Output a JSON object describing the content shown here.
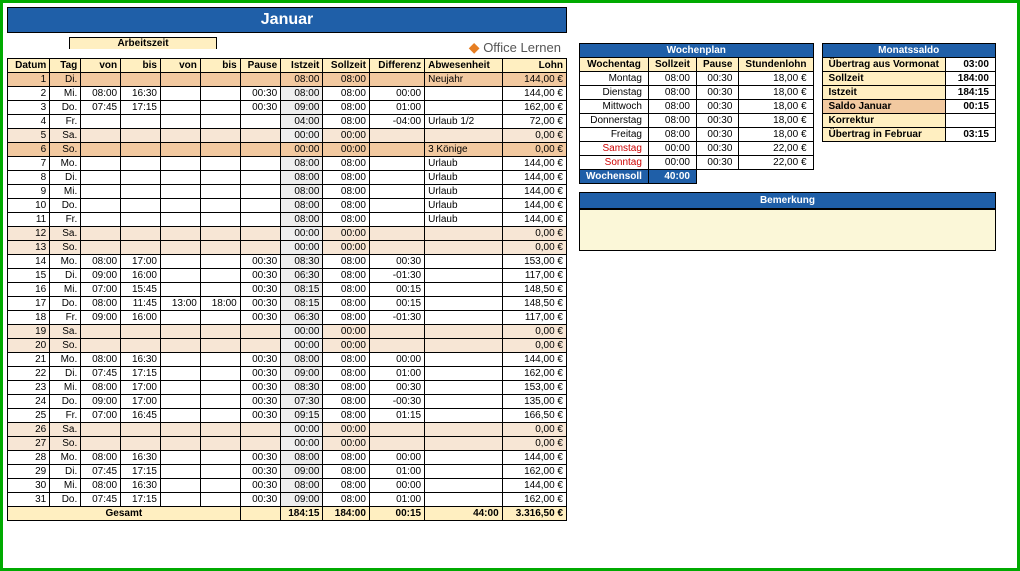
{
  "month": "Januar",
  "logo_text": "Office Lernen",
  "headers": {
    "datum": "Datum",
    "tag": "Tag",
    "arbeitszeit": "Arbeitszeit",
    "von": "von",
    "bis": "bis",
    "pause": "Pause",
    "istzeit": "Istzeit",
    "sollzeit": "Sollzeit",
    "differenz": "Differenz",
    "abwesenheit": "Abwesenheit",
    "lohn": "Lohn"
  },
  "rows": [
    {
      "d": "1",
      "t": "Di.",
      "v1": "",
      "b1": "",
      "v2": "",
      "b2": "",
      "p": "",
      "ist": "08:00",
      "soll": "08:00",
      "diff": "",
      "abw": "Neujahr",
      "lohn": "144,00 €",
      "hl": true
    },
    {
      "d": "2",
      "t": "Mi.",
      "v1": "08:00",
      "b1": "16:30",
      "v2": "",
      "b2": "",
      "p": "00:30",
      "ist": "08:00",
      "soll": "08:00",
      "diff": "00:00",
      "abw": "",
      "lohn": "144,00 €"
    },
    {
      "d": "3",
      "t": "Do.",
      "v1": "07:45",
      "b1": "17:15",
      "v2": "",
      "b2": "",
      "p": "00:30",
      "ist": "09:00",
      "soll": "08:00",
      "diff": "01:00",
      "abw": "",
      "lohn": "162,00 €"
    },
    {
      "d": "4",
      "t": "Fr.",
      "v1": "",
      "b1": "",
      "v2": "",
      "b2": "",
      "p": "",
      "ist": "04:00",
      "soll": "08:00",
      "diff": "-04:00",
      "abw": "Urlaub 1/2",
      "lohn": "72,00 €"
    },
    {
      "d": "5",
      "t": "Sa.",
      "v1": "",
      "b1": "",
      "v2": "",
      "b2": "",
      "p": "",
      "ist": "00:00",
      "soll": "00:00",
      "diff": "",
      "abw": "",
      "lohn": "0,00 €",
      "we": true
    },
    {
      "d": "6",
      "t": "So.",
      "v1": "",
      "b1": "",
      "v2": "",
      "b2": "",
      "p": "",
      "ist": "00:00",
      "soll": "00:00",
      "diff": "",
      "abw": "3 Könige",
      "lohn": "0,00 €",
      "hl": true
    },
    {
      "d": "7",
      "t": "Mo.",
      "v1": "",
      "b1": "",
      "v2": "",
      "b2": "",
      "p": "",
      "ist": "08:00",
      "soll": "08:00",
      "diff": "",
      "abw": "Urlaub",
      "lohn": "144,00 €"
    },
    {
      "d": "8",
      "t": "Di.",
      "v1": "",
      "b1": "",
      "v2": "",
      "b2": "",
      "p": "",
      "ist": "08:00",
      "soll": "08:00",
      "diff": "",
      "abw": "Urlaub",
      "lohn": "144,00 €"
    },
    {
      "d": "9",
      "t": "Mi.",
      "v1": "",
      "b1": "",
      "v2": "",
      "b2": "",
      "p": "",
      "ist": "08:00",
      "soll": "08:00",
      "diff": "",
      "abw": "Urlaub",
      "lohn": "144,00 €"
    },
    {
      "d": "10",
      "t": "Do.",
      "v1": "",
      "b1": "",
      "v2": "",
      "b2": "",
      "p": "",
      "ist": "08:00",
      "soll": "08:00",
      "diff": "",
      "abw": "Urlaub",
      "lohn": "144,00 €"
    },
    {
      "d": "11",
      "t": "Fr.",
      "v1": "",
      "b1": "",
      "v2": "",
      "b2": "",
      "p": "",
      "ist": "08:00",
      "soll": "08:00",
      "diff": "",
      "abw": "Urlaub",
      "lohn": "144,00 €"
    },
    {
      "d": "12",
      "t": "Sa.",
      "v1": "",
      "b1": "",
      "v2": "",
      "b2": "",
      "p": "",
      "ist": "00:00",
      "soll": "00:00",
      "diff": "",
      "abw": "",
      "lohn": "0,00 €",
      "we": true
    },
    {
      "d": "13",
      "t": "So.",
      "v1": "",
      "b1": "",
      "v2": "",
      "b2": "",
      "p": "",
      "ist": "00:00",
      "soll": "00:00",
      "diff": "",
      "abw": "",
      "lohn": "0,00 €",
      "we": true
    },
    {
      "d": "14",
      "t": "Mo.",
      "v1": "08:00",
      "b1": "17:00",
      "v2": "",
      "b2": "",
      "p": "00:30",
      "ist": "08:30",
      "soll": "08:00",
      "diff": "00:30",
      "abw": "",
      "lohn": "153,00 €"
    },
    {
      "d": "15",
      "t": "Di.",
      "v1": "09:00",
      "b1": "16:00",
      "v2": "",
      "b2": "",
      "p": "00:30",
      "ist": "06:30",
      "soll": "08:00",
      "diff": "-01:30",
      "abw": "",
      "lohn": "117,00 €"
    },
    {
      "d": "16",
      "t": "Mi.",
      "v1": "07:00",
      "b1": "15:45",
      "v2": "",
      "b2": "",
      "p": "00:30",
      "ist": "08:15",
      "soll": "08:00",
      "diff": "00:15",
      "abw": "",
      "lohn": "148,50 €"
    },
    {
      "d": "17",
      "t": "Do.",
      "v1": "08:00",
      "b1": "11:45",
      "v2": "13:00",
      "b2": "18:00",
      "p": "00:30",
      "ist": "08:15",
      "soll": "08:00",
      "diff": "00:15",
      "abw": "",
      "lohn": "148,50 €"
    },
    {
      "d": "18",
      "t": "Fr.",
      "v1": "09:00",
      "b1": "16:00",
      "v2": "",
      "b2": "",
      "p": "00:30",
      "ist": "06:30",
      "soll": "08:00",
      "diff": "-01:30",
      "abw": "",
      "lohn": "117,00 €"
    },
    {
      "d": "19",
      "t": "Sa.",
      "v1": "",
      "b1": "",
      "v2": "",
      "b2": "",
      "p": "",
      "ist": "00:00",
      "soll": "00:00",
      "diff": "",
      "abw": "",
      "lohn": "0,00 €",
      "we": true
    },
    {
      "d": "20",
      "t": "So.",
      "v1": "",
      "b1": "",
      "v2": "",
      "b2": "",
      "p": "",
      "ist": "00:00",
      "soll": "00:00",
      "diff": "",
      "abw": "",
      "lohn": "0,00 €",
      "we": true
    },
    {
      "d": "21",
      "t": "Mo.",
      "v1": "08:00",
      "b1": "16:30",
      "v2": "",
      "b2": "",
      "p": "00:30",
      "ist": "08:00",
      "soll": "08:00",
      "diff": "00:00",
      "abw": "",
      "lohn": "144,00 €"
    },
    {
      "d": "22",
      "t": "Di.",
      "v1": "07:45",
      "b1": "17:15",
      "v2": "",
      "b2": "",
      "p": "00:30",
      "ist": "09:00",
      "soll": "08:00",
      "diff": "01:00",
      "abw": "",
      "lohn": "162,00 €"
    },
    {
      "d": "23",
      "t": "Mi.",
      "v1": "08:00",
      "b1": "17:00",
      "v2": "",
      "b2": "",
      "p": "00:30",
      "ist": "08:30",
      "soll": "08:00",
      "diff": "00:30",
      "abw": "",
      "lohn": "153,00 €"
    },
    {
      "d": "24",
      "t": "Do.",
      "v1": "09:00",
      "b1": "17:00",
      "v2": "",
      "b2": "",
      "p": "00:30",
      "ist": "07:30",
      "soll": "08:00",
      "diff": "-00:30",
      "abw": "",
      "lohn": "135,00 €"
    },
    {
      "d": "25",
      "t": "Fr.",
      "v1": "07:00",
      "b1": "16:45",
      "v2": "",
      "b2": "",
      "p": "00:30",
      "ist": "09:15",
      "soll": "08:00",
      "diff": "01:15",
      "abw": "",
      "lohn": "166,50 €"
    },
    {
      "d": "26",
      "t": "Sa.",
      "v1": "",
      "b1": "",
      "v2": "",
      "b2": "",
      "p": "",
      "ist": "00:00",
      "soll": "00:00",
      "diff": "",
      "abw": "",
      "lohn": "0,00 €",
      "we": true
    },
    {
      "d": "27",
      "t": "So.",
      "v1": "",
      "b1": "",
      "v2": "",
      "b2": "",
      "p": "",
      "ist": "00:00",
      "soll": "00:00",
      "diff": "",
      "abw": "",
      "lohn": "0,00 €",
      "we": true
    },
    {
      "d": "28",
      "t": "Mo.",
      "v1": "08:00",
      "b1": "16:30",
      "v2": "",
      "b2": "",
      "p": "00:30",
      "ist": "08:00",
      "soll": "08:00",
      "diff": "00:00",
      "abw": "",
      "lohn": "144,00 €"
    },
    {
      "d": "29",
      "t": "Di.",
      "v1": "07:45",
      "b1": "17:15",
      "v2": "",
      "b2": "",
      "p": "00:30",
      "ist": "09:00",
      "soll": "08:00",
      "diff": "01:00",
      "abw": "",
      "lohn": "162,00 €"
    },
    {
      "d": "30",
      "t": "Mi.",
      "v1": "08:00",
      "b1": "16:30",
      "v2": "",
      "b2": "",
      "p": "00:30",
      "ist": "08:00",
      "soll": "08:00",
      "diff": "00:00",
      "abw": "",
      "lohn": "144,00 €"
    },
    {
      "d": "31",
      "t": "Do.",
      "v1": "07:45",
      "b1": "17:15",
      "v2": "",
      "b2": "",
      "p": "00:30",
      "ist": "09:00",
      "soll": "08:00",
      "diff": "01:00",
      "abw": "",
      "lohn": "162,00 €"
    }
  ],
  "totals": {
    "label": "Gesamt",
    "ist": "184:15",
    "soll": "184:00",
    "diff": "00:15",
    "abw": "44:00",
    "lohn": "3.316,50 €"
  },
  "wochenplan": {
    "title": "Wochenplan",
    "headers": {
      "tag": "Wochentag",
      "soll": "Sollzeit",
      "pause": "Pause",
      "stdl": "Stundenlohn"
    },
    "rows": [
      {
        "t": "Montag",
        "s": "08:00",
        "p": "00:30",
        "l": "18,00 €"
      },
      {
        "t": "Dienstag",
        "s": "08:00",
        "p": "00:30",
        "l": "18,00 €"
      },
      {
        "t": "Mittwoch",
        "s": "08:00",
        "p": "00:30",
        "l": "18,00 €"
      },
      {
        "t": "Donnerstag",
        "s": "08:00",
        "p": "00:30",
        "l": "18,00 €"
      },
      {
        "t": "Freitag",
        "s": "08:00",
        "p": "00:30",
        "l": "18,00 €"
      },
      {
        "t": "Samstag",
        "s": "00:00",
        "p": "00:30",
        "l": "22,00 €",
        "red": true
      },
      {
        "t": "Sonntag",
        "s": "00:00",
        "p": "00:30",
        "l": "22,00 €",
        "red": true
      }
    ],
    "wochensoll_label": "Wochensoll",
    "wochensoll_val": "40:00"
  },
  "monatssaldo": {
    "title": "Monatssaldo",
    "rows": [
      {
        "l": "Übertrag aus Vormonat",
        "v": "03:00"
      },
      {
        "l": "Sollzeit",
        "v": "184:00"
      },
      {
        "l": "Istzeit",
        "v": "184:15"
      },
      {
        "l": "Saldo Januar",
        "v": "00:15",
        "hl": true
      },
      {
        "l": "Korrektur",
        "v": ""
      },
      {
        "l": "Übertrag in Februar",
        "v": "03:15"
      }
    ]
  },
  "bemerkung": {
    "title": "Bemerkung",
    "text": ""
  }
}
